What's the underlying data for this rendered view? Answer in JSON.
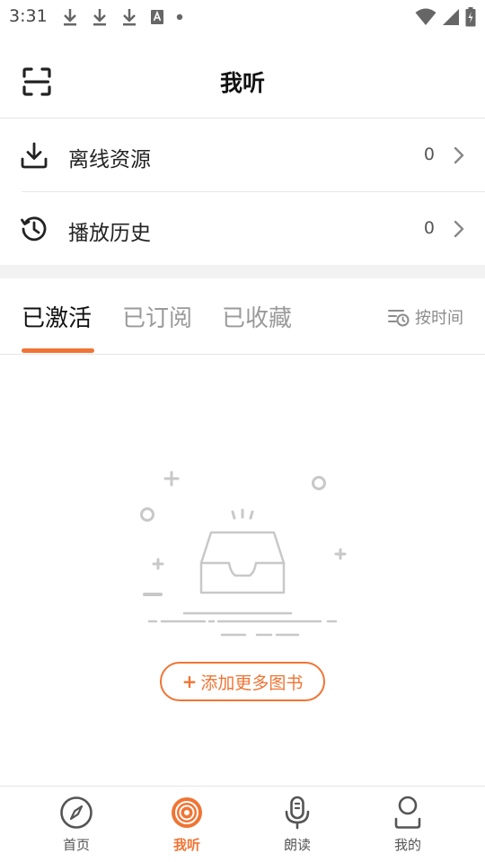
{
  "status_bar": {
    "time": "3:31",
    "left_icons": [
      "download-icon",
      "download-icon",
      "download-icon",
      "font-a-icon",
      "dot-icon"
    ],
    "right_icons": [
      "wifi-icon",
      "signal-icon",
      "battery-charging-icon"
    ]
  },
  "header": {
    "title": "我听",
    "scan_icon": "scan-icon"
  },
  "menu": [
    {
      "label": "离线资源",
      "count": "0",
      "icon": "download-icon"
    },
    {
      "label": "播放历史",
      "count": "0",
      "icon": "history-icon"
    }
  ],
  "tabs": {
    "items": [
      "已激活",
      "已订阅",
      "已收藏"
    ],
    "active_index": 0,
    "sort_label": "按时间",
    "sort_icon": "sort-time-icon"
  },
  "empty_state": {
    "illustration": "empty-inbox-icon",
    "button_label": "添加更多图书",
    "button_prefix": "+"
  },
  "bottom_nav": {
    "items": [
      {
        "label": "首页",
        "icon": "compass-icon"
      },
      {
        "label": "我听",
        "icon": "vinyl-icon"
      },
      {
        "label": "朗读",
        "icon": "microphone-icon"
      },
      {
        "label": "我的",
        "icon": "person-icon"
      }
    ],
    "active_index": 1
  },
  "colors": {
    "accent": "#f07434",
    "divider": "#e6e6e6",
    "gap": "#f2f2f2"
  }
}
